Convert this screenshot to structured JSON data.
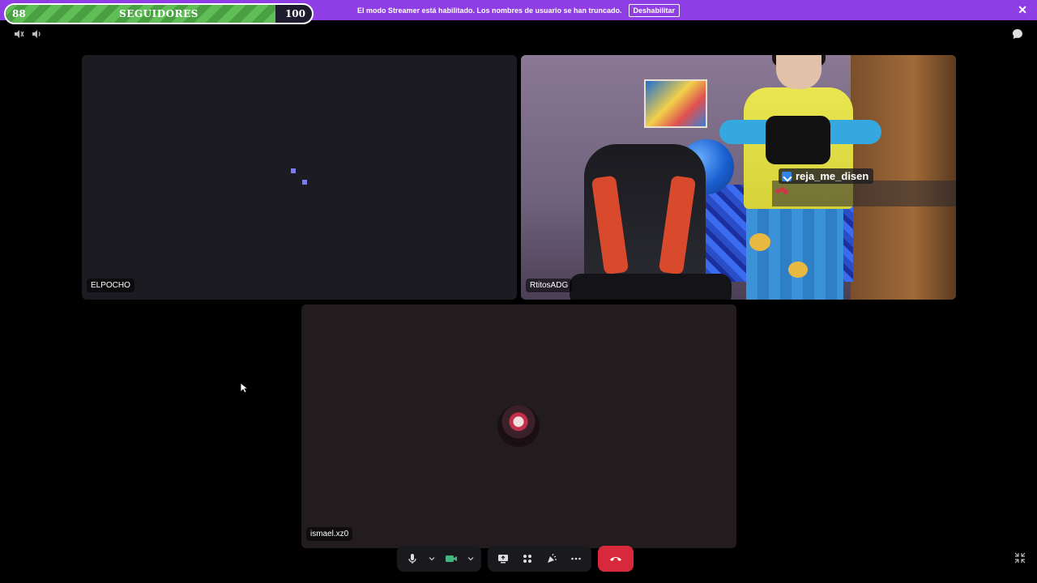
{
  "banner": {
    "message": "El modo Streamer está habilitado. Los nombres de usuario se han truncado.",
    "button_label": "Deshabilitar",
    "close_glyph": "✕",
    "color": "#8f3ee6"
  },
  "goal": {
    "current": "88",
    "label": "SEGUIDORES",
    "target": "100",
    "progress": 0.88,
    "fill_color": "#5fbe55"
  },
  "tiles": [
    {
      "name": "ELPOCHO",
      "state": "loading"
    },
    {
      "name": "RtitosADG",
      "state": "video",
      "overlay_user": "reja_me_disen"
    },
    {
      "name": "ismael.xz0",
      "state": "avatar"
    }
  ],
  "controls": {
    "icons": [
      "microphone-icon",
      "chevron-down-icon",
      "camera-icon",
      "chevron-down-icon",
      "screen-share-icon",
      "activities-icon",
      "soundboard-icon",
      "more-icon",
      "hang-up-icon"
    ],
    "camera_color": "#43b581",
    "hangup_color": "#d8283c"
  },
  "icons": {
    "top_left": [
      "speaker-muted-icon",
      "speaker-icon"
    ],
    "top_right": "chat-bubble-icon",
    "bottom_right": "shrink-icon"
  }
}
